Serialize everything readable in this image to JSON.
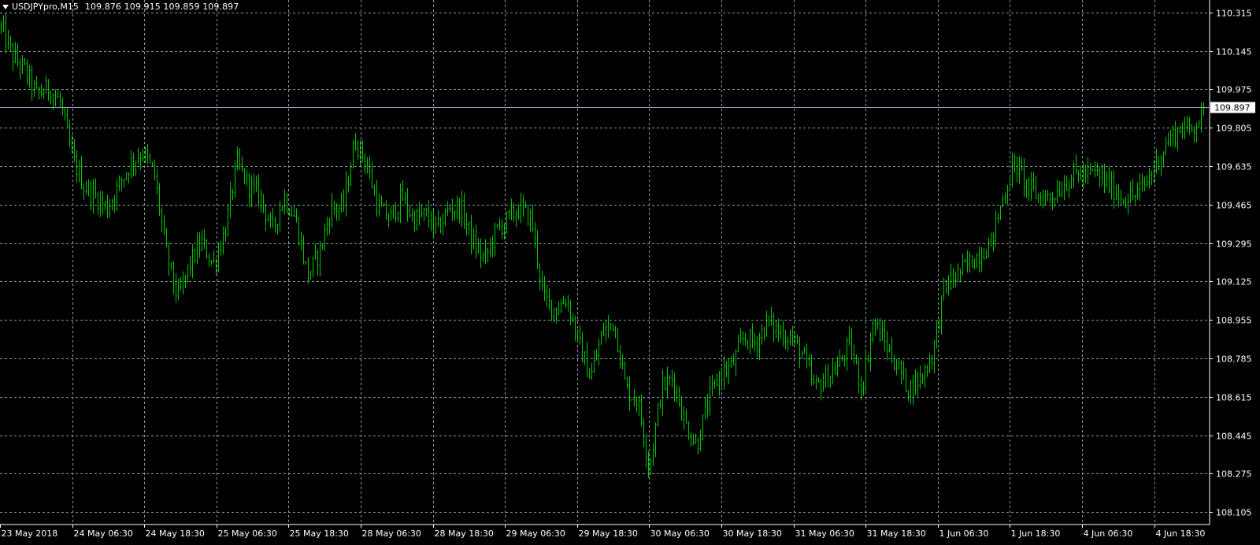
{
  "header": {
    "symbol": "USDJPYpro,M15",
    "ohlc": "109.876 109.915 109.859 109.897"
  },
  "chart_data": {
    "type": "bar",
    "series_label": "USDJPYpro,M15",
    "ylim": [
      108.05,
      110.37
    ],
    "y_ticks": [
      "110.315",
      "110.145",
      "109.975",
      "109.805",
      "109.635",
      "109.465",
      "109.295",
      "109.125",
      "108.955",
      "108.785",
      "108.615",
      "108.445",
      "108.275",
      "108.105"
    ],
    "current_price": "109.897",
    "x_ticks": [
      "23 May 2018",
      "24 May 06:30",
      "24 May 18:30",
      "25 May 06:30",
      "25 May 18:30",
      "28 May 06:30",
      "28 May 18:30",
      "29 May 06:30",
      "29 May 18:30",
      "30 May 06:30",
      "30 May 18:30",
      "31 May 06:30",
      "31 May 18:30",
      "1 Jun 06:30",
      "1 Jun 18:30",
      "4 Jun 06:30",
      "4 Jun 18:30"
    ],
    "grid": true,
    "colors": {
      "background": "#000000",
      "bars": "#00c800",
      "grid": "#8a9ba8",
      "text": "#ffffff",
      "price_line": "#8aa0b8"
    },
    "path_closes": [
      110.25,
      110.12,
      110.06,
      109.95,
      109.98,
      109.92,
      109.68,
      109.55,
      109.5,
      109.45,
      109.55,
      109.65,
      109.7,
      109.6,
      109.25,
      109.05,
      109.2,
      109.3,
      109.2,
      109.35,
      109.65,
      109.55,
      109.5,
      109.35,
      109.5,
      109.4,
      109.15,
      109.25,
      109.45,
      109.45,
      109.75,
      109.65,
      109.45,
      109.4,
      109.5,
      109.4,
      109.42,
      109.35,
      109.45,
      109.45,
      109.3,
      109.22,
      109.35,
      109.4,
      109.45,
      109.4,
      109.05,
      109.0,
      109.05,
      108.85,
      108.7,
      108.9,
      108.95,
      108.65,
      108.6,
      108.3,
      108.65,
      108.7,
      108.5,
      108.4,
      108.6,
      108.72,
      108.75,
      108.88,
      108.85,
      108.95,
      108.9,
      108.88,
      108.8,
      108.65,
      108.7,
      108.75,
      108.85,
      108.65,
      108.95,
      108.85,
      108.75,
      108.65,
      108.7,
      108.8,
      109.1,
      109.15,
      109.2,
      109.25,
      109.3,
      109.5,
      109.65,
      109.55,
      109.5,
      109.5,
      109.55,
      109.6,
      109.6,
      109.6,
      109.55,
      109.5,
      109.5,
      109.55,
      109.65,
      109.75,
      109.8,
      109.8,
      109.88
    ],
    "last_bar": {
      "open": 109.876,
      "high": 109.915,
      "low": 109.859,
      "close": 109.897
    }
  }
}
